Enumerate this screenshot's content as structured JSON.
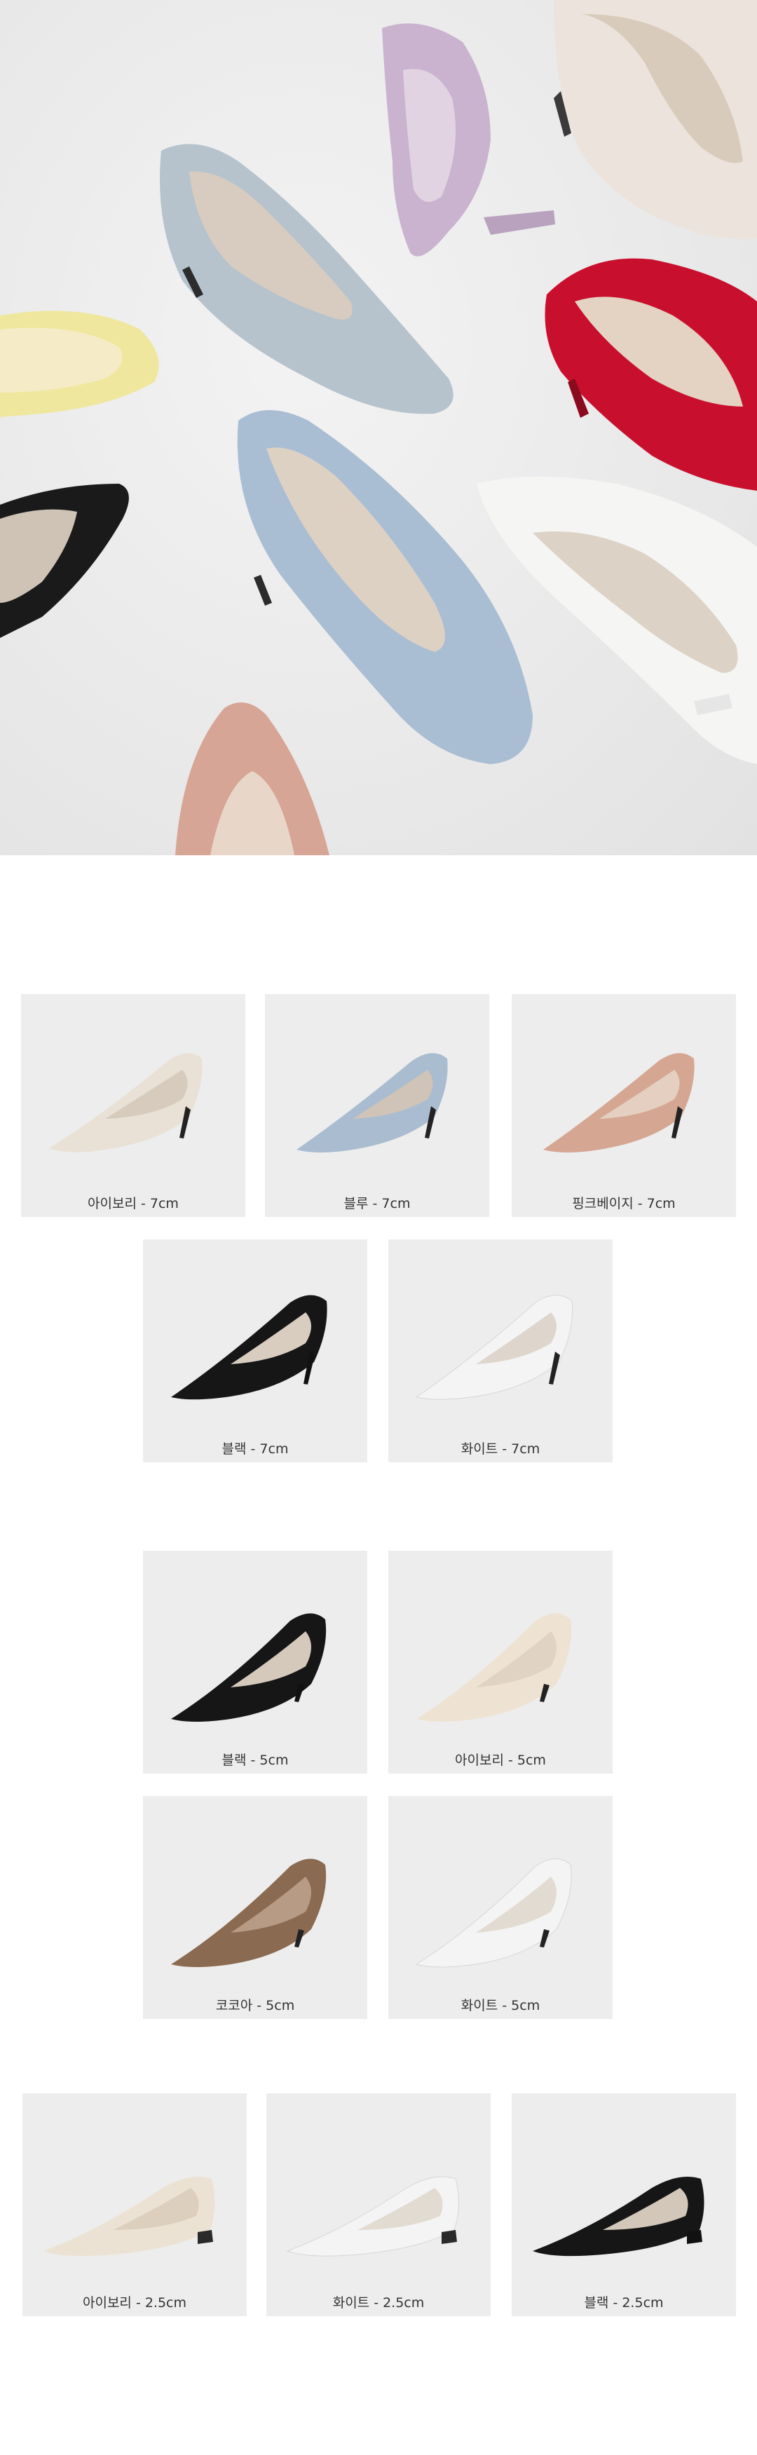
{
  "hero": {
    "shoe_colors": {
      "lavender": "#c9b3cf",
      "ivory": "#ece3dc",
      "light_blue_gray": "#b6c3cc",
      "yellow": "#efe79e",
      "red": "#c8102e",
      "black": "#1a1a1a",
      "sky_blue": "#a9bdd3",
      "white": "#f5f5f3",
      "pink_beige": "#d7a596"
    }
  },
  "group_7cm": {
    "items": [
      {
        "caption": "아이보리 - 7cm",
        "color": "#e9e1d6"
      },
      {
        "caption": "블루 - 7cm",
        "color": "#a9bcd0"
      },
      {
        "caption": "핑크베이지 - 7cm",
        "color": "#d5a793"
      },
      {
        "caption": "블랙 - 7cm",
        "color": "#161616"
      },
      {
        "caption": "화이트 - 7cm",
        "color": "#f4f4f4"
      }
    ]
  },
  "group_5cm": {
    "items": [
      {
        "caption": "블랙 - 5cm",
        "color": "#161616"
      },
      {
        "caption": "아이보리 - 5cm",
        "color": "#eee2d3"
      },
      {
        "caption": "코코아 - 5cm",
        "color": "#8a6a50"
      },
      {
        "caption": "화이트 - 5cm",
        "color": "#f4f4f4"
      }
    ]
  },
  "group_25cm": {
    "items": [
      {
        "caption": "아이보리 - 2.5cm",
        "color": "#ece2d3"
      },
      {
        "caption": "화이트 - 2.5cm",
        "color": "#f4f4f4"
      },
      {
        "caption": "블랙 - 2.5cm",
        "color": "#161616"
      }
    ]
  }
}
